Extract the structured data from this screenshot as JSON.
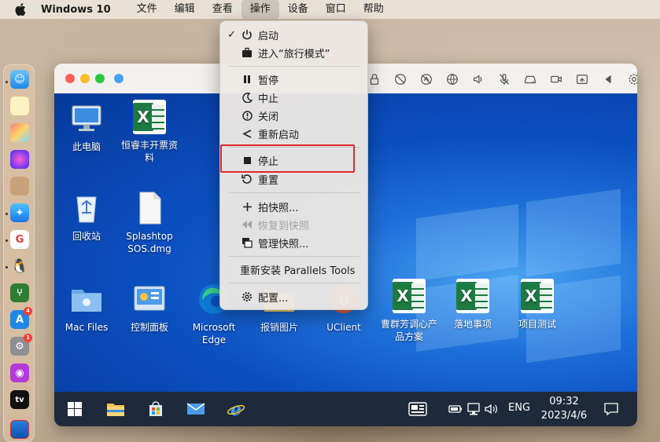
{
  "menubar": {
    "app_name": "Windows 10",
    "items": [
      "文件",
      "编辑",
      "查看",
      "操作",
      "设备",
      "窗口",
      "帮助"
    ],
    "active": "操作"
  },
  "menu": {
    "items": [
      {
        "label": "启动",
        "icon": "power-icon",
        "checked": "✓"
      },
      {
        "label": "进入“旅行模式”",
        "icon": "briefcase-icon"
      },
      {
        "label": "暂停",
        "icon": "pause-icon"
      },
      {
        "label": "中止",
        "icon": "moon-icon"
      },
      {
        "label": "关闭",
        "icon": "shutdown-icon"
      },
      {
        "label": "重新启动",
        "icon": "restart-icon"
      },
      {
        "label": "停止",
        "icon": "stop-icon"
      },
      {
        "label": "重置",
        "icon": "reset-icon"
      },
      {
        "label": "拍快照...",
        "icon": "plus-icon"
      },
      {
        "label": "恢复到快照",
        "icon": "rewind-icon",
        "disabled": true
      },
      {
        "label": "管理快照...",
        "icon": "snapshots-icon"
      },
      {
        "label": "重新安装 Parallels Tools",
        "icon": ""
      },
      {
        "label": "配置...",
        "icon": "gear-icon"
      }
    ]
  },
  "desktop": {
    "icons": [
      {
        "label": "此电脑",
        "icon": "computer-icon"
      },
      {
        "label": "恒睿丰开票资料",
        "icon": "excel-icon"
      },
      {
        "label": "回收站",
        "icon": "recycle-bin-icon"
      },
      {
        "label": "Splashtop SOS.dmg",
        "icon": "file-icon"
      },
      {
        "label": "Mac Files",
        "icon": "mac-folder-icon"
      },
      {
        "label": "控制面板",
        "icon": "control-panel-icon"
      },
      {
        "label": "Microsoft Edge",
        "icon": "edge-icon"
      },
      {
        "label": "报销图片",
        "icon": "folder-icon"
      },
      {
        "label": "UClient",
        "icon": "uclient-icon"
      },
      {
        "label": "曹群芳调心产品方案",
        "icon": "excel-icon"
      },
      {
        "label": "落地事项",
        "icon": "excel-icon"
      },
      {
        "label": "项目测试",
        "icon": "excel-icon"
      }
    ]
  },
  "taskbar": {
    "language": "ENG",
    "time": "09:32",
    "date": "2023/4/6"
  },
  "colors": {
    "highlight": "#e3262d",
    "win_blue": "#0b4fbf",
    "excel_green": "#1d7a43"
  }
}
